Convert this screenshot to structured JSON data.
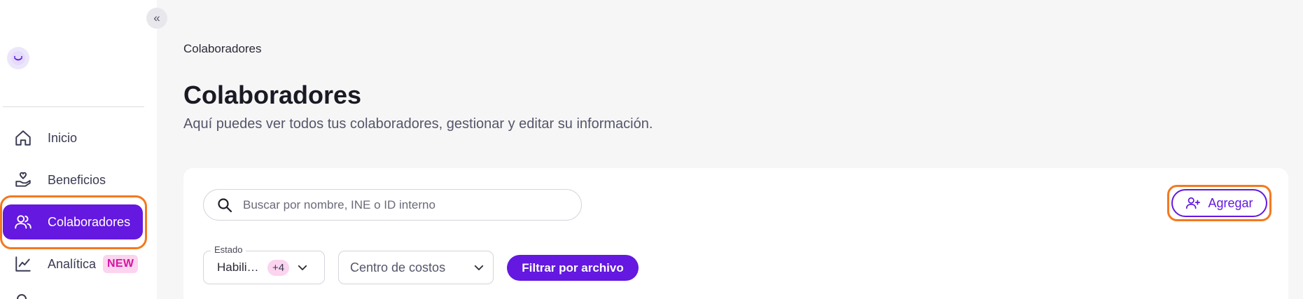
{
  "sidebar": {
    "collapse_icon": "«",
    "items": [
      {
        "label": "Inicio",
        "icon": "home-icon"
      },
      {
        "label": "Beneficios",
        "icon": "hand-heart-icon"
      },
      {
        "label": "Colaboradores",
        "icon": "users-icon",
        "active": true
      },
      {
        "label": "Analítica",
        "icon": "line-chart-icon",
        "badge": "NEW"
      }
    ]
  },
  "breadcrumb": "Colaboradores",
  "page": {
    "title": "Colaboradores",
    "subtitle": "Aquí puedes ver todos tus colaboradores, gestionar y editar su información."
  },
  "search": {
    "placeholder": "Buscar por nombre, INE o ID interno",
    "value": ""
  },
  "add_button": {
    "label": "Agregar"
  },
  "filters": {
    "estado": {
      "label": "Estado",
      "value": "Habilit...",
      "count": "+4"
    },
    "centro": {
      "placeholder": "Centro de costos"
    },
    "filtrar_button": "Filtrar por archivo"
  },
  "colors": {
    "accent": "#6418e0",
    "highlight": "#f3791f",
    "badge_bg": "#fbd4ef",
    "badge_text": "#d614a3"
  }
}
